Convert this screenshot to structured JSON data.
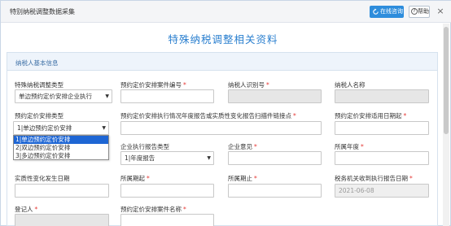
{
  "window": {
    "title": "特别纳税调整数据采集",
    "online_consult": "在线咨询",
    "help": "帮助",
    "close": "×"
  },
  "page_title": "特殊纳税调整相关资料",
  "section": {
    "title": "纳税人基本信息"
  },
  "fields": {
    "r1": {
      "type_label": "特殊纳税调整类型",
      "type_value": "单边预约定价安排企业执行",
      "case_no_label": "预约定价安排案件编号",
      "taxpayer_id_label": "纳税人识别号",
      "taxpayer_name_label": "纳税人名称"
    },
    "r2": {
      "apa_type_label": "预约定价安排类型",
      "apa_type_value": "1|单边预约定价安排",
      "scan_link_label": "预约定价安排执行情况年度报告或实质性变化报告扫描件链接点",
      "start_date_label": "预约定价安排适用日期起"
    },
    "r3": {
      "report_type_label": "企业执行报告类型",
      "report_type_value": "1|年度报告",
      "opinion_label": "企业意见",
      "year_label": "所属年度"
    },
    "r4": {
      "change_date_label": "实质性变化发生日期",
      "period_start_label": "所属期起",
      "period_end_label": "所属期止",
      "receive_date_label": "税务机关收到执行报告日期",
      "receive_date_value": "2021-06-08"
    },
    "r5": {
      "registrant_label": "登记人",
      "case_name_label": "预约定价安排案件名称"
    }
  },
  "dropdown_options": [
    "1|单边预约定价安排",
    "2|双边预约定价安排",
    "3|多边预约定价安排"
  ],
  "required_mark": "*",
  "colors": {
    "accent": "#2a7fcf",
    "button": "#2e8ddc",
    "required": "#e53935",
    "highlight": "#1e66d4"
  }
}
